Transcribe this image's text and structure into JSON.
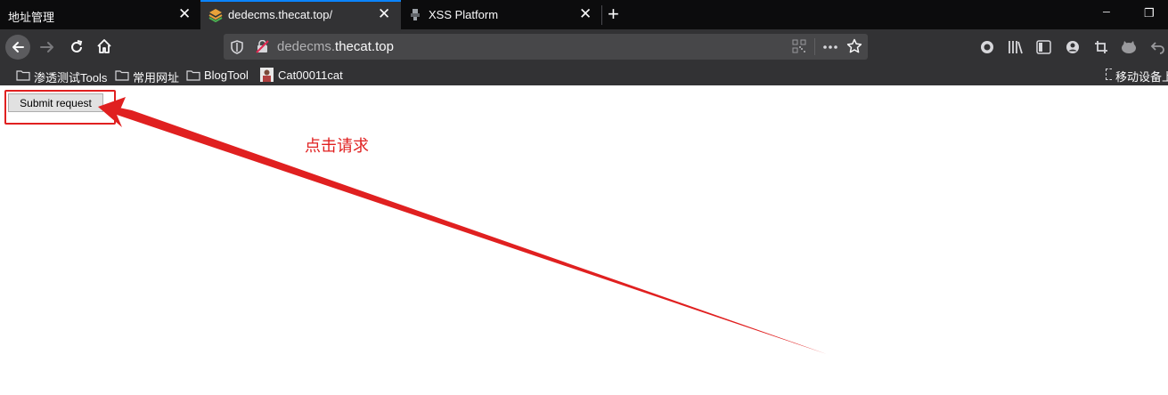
{
  "tabs": [
    {
      "label": "地址管理",
      "close": "✕"
    },
    {
      "label": "dedecms.thecat.top/",
      "close": "✕"
    },
    {
      "label": "XSS Platform",
      "close": "✕"
    }
  ],
  "new_tab": "+",
  "window_controls": {
    "minimize": "─",
    "restore": "❐"
  },
  "url": {
    "prefix": "dedecms.",
    "host": "thecat.top"
  },
  "bookmarks": [
    {
      "label": "渗透测试Tools",
      "icon": "folder-icon"
    },
    {
      "label": "常用网址",
      "icon": "folder-icon"
    },
    {
      "label": "BlogTool",
      "icon": "folder-icon"
    },
    {
      "label": "Cat00011cat",
      "icon": "avatar-icon"
    }
  ],
  "mobile_bookmarks": "移动设备上",
  "page": {
    "submit_label": "Submit request"
  },
  "annotation": {
    "text": "点击请求",
    "color": "#e02020"
  },
  "colors": {
    "accent": "#0a84ff",
    "toolbar": "#323234",
    "titlebar": "#0c0c0d",
    "annotation": "#e02020"
  }
}
